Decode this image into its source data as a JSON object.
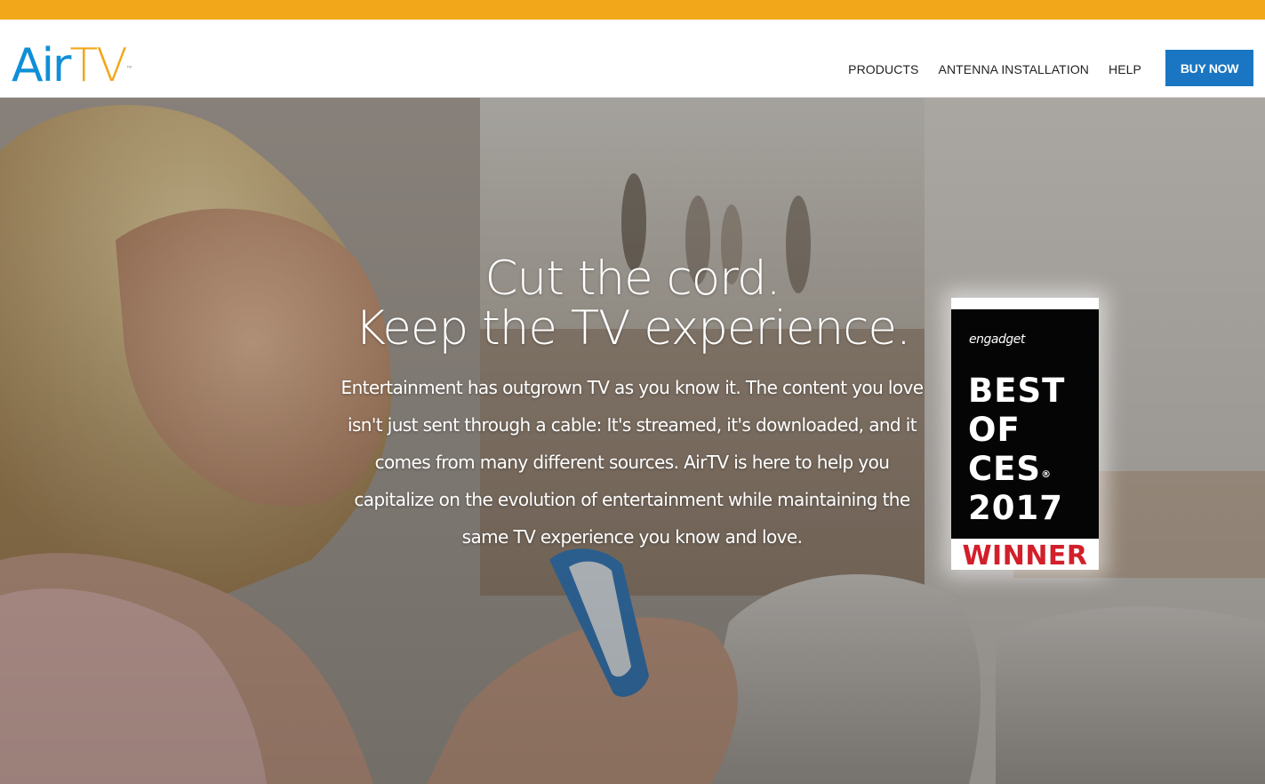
{
  "header": {
    "logo": {
      "part1": "Air",
      "part2": "TV",
      "mark": "™"
    },
    "nav": [
      {
        "label": "PRODUCTS"
      },
      {
        "label": "ANTENNA INSTALLATION"
      },
      {
        "label": "HELP"
      }
    ],
    "cta": "BUY NOW"
  },
  "hero": {
    "headline_line1": "Cut the cord.",
    "headline_line2": "Keep the TV experience.",
    "body": "Entertainment has outgrown TV as you know it. The content you love isn't just sent through a cable: It's streamed, it's downloaded, and it comes from many different sources. AirTV is here to help you capitalize on the evolution of entertainment while maintaining the same TV experience you know and love."
  },
  "badge": {
    "brand": "engadget",
    "line1": "BEST",
    "line2": "OF",
    "line3": "CES",
    "reg": "®",
    "line4": "2017",
    "winner": "WINNER"
  },
  "colors": {
    "top_bar": "#F2A71B",
    "logo_blue": "#0F8FD8",
    "logo_orange": "#F2A71B",
    "cta_blue": "#1A76C2",
    "winner_red": "#D21F2A"
  }
}
